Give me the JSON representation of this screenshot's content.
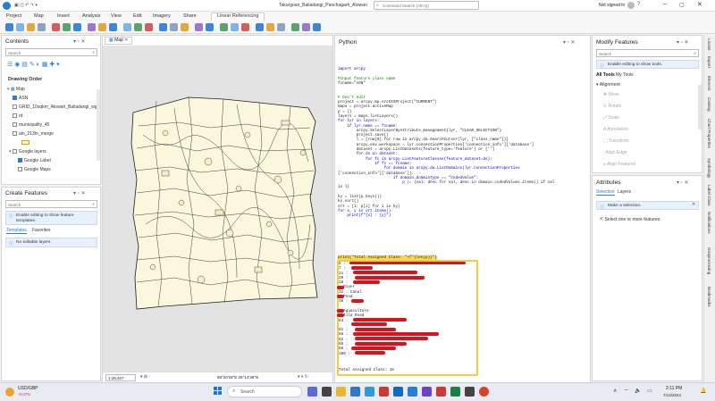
{
  "titlebar": {
    "project_title": "Takurgoan_Baliadangi_Panchagarh_Atowari",
    "search_placeholder": "Command Search (Alt+Q)",
    "signin": "Not signed in"
  },
  "ribbon": {
    "tabs": [
      "Project",
      "Map",
      "Insert",
      "Analysis",
      "View",
      "Edit",
      "Imagery",
      "Share",
      "Linear Referencing"
    ],
    "active_tab": "Linear Referencing"
  },
  "contents": {
    "title": "Contents",
    "search_placeholder": "Search",
    "drawing_order": "Drawing Order",
    "layers": [
      "Map",
      "ASN",
      "GRID_10sqkm_Atowari_Baliadangi_wg",
      "rd",
      "municipality_45",
      "ain_213m_merge",
      "Google layers",
      "Google Label",
      "Google Maps"
    ]
  },
  "create_features": {
    "title": "Create Features",
    "search_placeholder": "Search",
    "info": "Enable editing to show feature templates.",
    "tabs": [
      "Templates",
      "Favorites"
    ],
    "no_layers": "No editable layers"
  },
  "map": {
    "tab_label": "Map",
    "scale": "1:28,407",
    "coords": "88°20'28\"E 26°14'38\"N"
  },
  "python": {
    "title": "Python",
    "code_top": [
      "import arcpy",
      "",
      "#Input feature class name",
      "fcname=\"ASN\"",
      "",
      "",
      "# Don't edit",
      "project = arcpy.mp.ArcGISProject(\"CURRENT\")",
      "maps = project.activeMap",
      "p = {}",
      "layers = maps.listLayers()",
      "for lyr in layers:",
      "    if lyr.name == fcname:",
      "        arcpy.SelectLayerByAttribute_management(lyr, \"CLEAR_SELECTION\")",
      "        project.save()",
      "        l = [row[0] for row in arcpy.da.SearchCursor(lyr, [\"class_name\"])]",
      "        arcpy.env.workspace = lyr.connectionProperties['connection_info']['database']",
      "        dataset = arcpy.ListDatasets(feature_type='feature') or ['']",
      "        for ds in dataset:",
      "            for fc in arcpy.ListFeatureClasses(feature_dataset=ds):",
      "                if fc == fcname:",
      "                    for domain in arcpy.da.ListDomains(lyr.connectionProperties",
      "['connection_info']['database']):",
      "                        if domain.domainType == \"CodedValue\":",
      "                            p |= {val: desc for val, desc in domain.codedValues.items() if val",
      "in l}",
      "",
      "ky = list(p.keys())",
      "ky.sort()",
      "srt = {i: p[i] for i in ky}",
      "for x, y in srt.items():",
      "    print(f\"{x} : {y}\")"
    ],
    "print_line": "print(\"Total Assigned Class: \"+f\"{len(p)}\")",
    "output": [
      "6 :",
      "7 :",
      "11 :",
      "20 :",
      "28 :",
      ": River",
      "32 : Canal",
      ": Pond",
      "36 :",
      "",
      ": Aquaculture",
      ": Illa Road",
      "64 :",
      "",
      "61 :",
      "68 :",
      "62 :",
      "66 :",
      "86 :",
      "100 :"
    ],
    "total": "Total Assigned Class: 18"
  },
  "modify": {
    "title": "Modify Features",
    "search_placeholder": "Search",
    "info": "Enable editing to show tools.",
    "tabs": [
      "All Tools",
      "My Tools"
    ],
    "section": "Alignment",
    "tools": [
      "Move",
      "Rotate",
      "Scale",
      "Annotation",
      "Transform",
      "Align Edge",
      "Align Features"
    ]
  },
  "attributes": {
    "title": "Attributes",
    "tabs": [
      "Selection",
      "Layers"
    ],
    "info": "Make a selection.",
    "select_prompt": "Select one or more features"
  },
  "side_tabs": [
    "Locate",
    "Export",
    "Element",
    "Catalog",
    "Chart Properties",
    "Symbology",
    "Label Class",
    "Notifications",
    "Geoprocessing",
    "Bookmarks"
  ],
  "taskbar": {
    "weather_title": "USD/GBP",
    "weather_value": "-0.07%",
    "search": "Search",
    "time": "2:11 PM",
    "date": "7/14/2024"
  }
}
